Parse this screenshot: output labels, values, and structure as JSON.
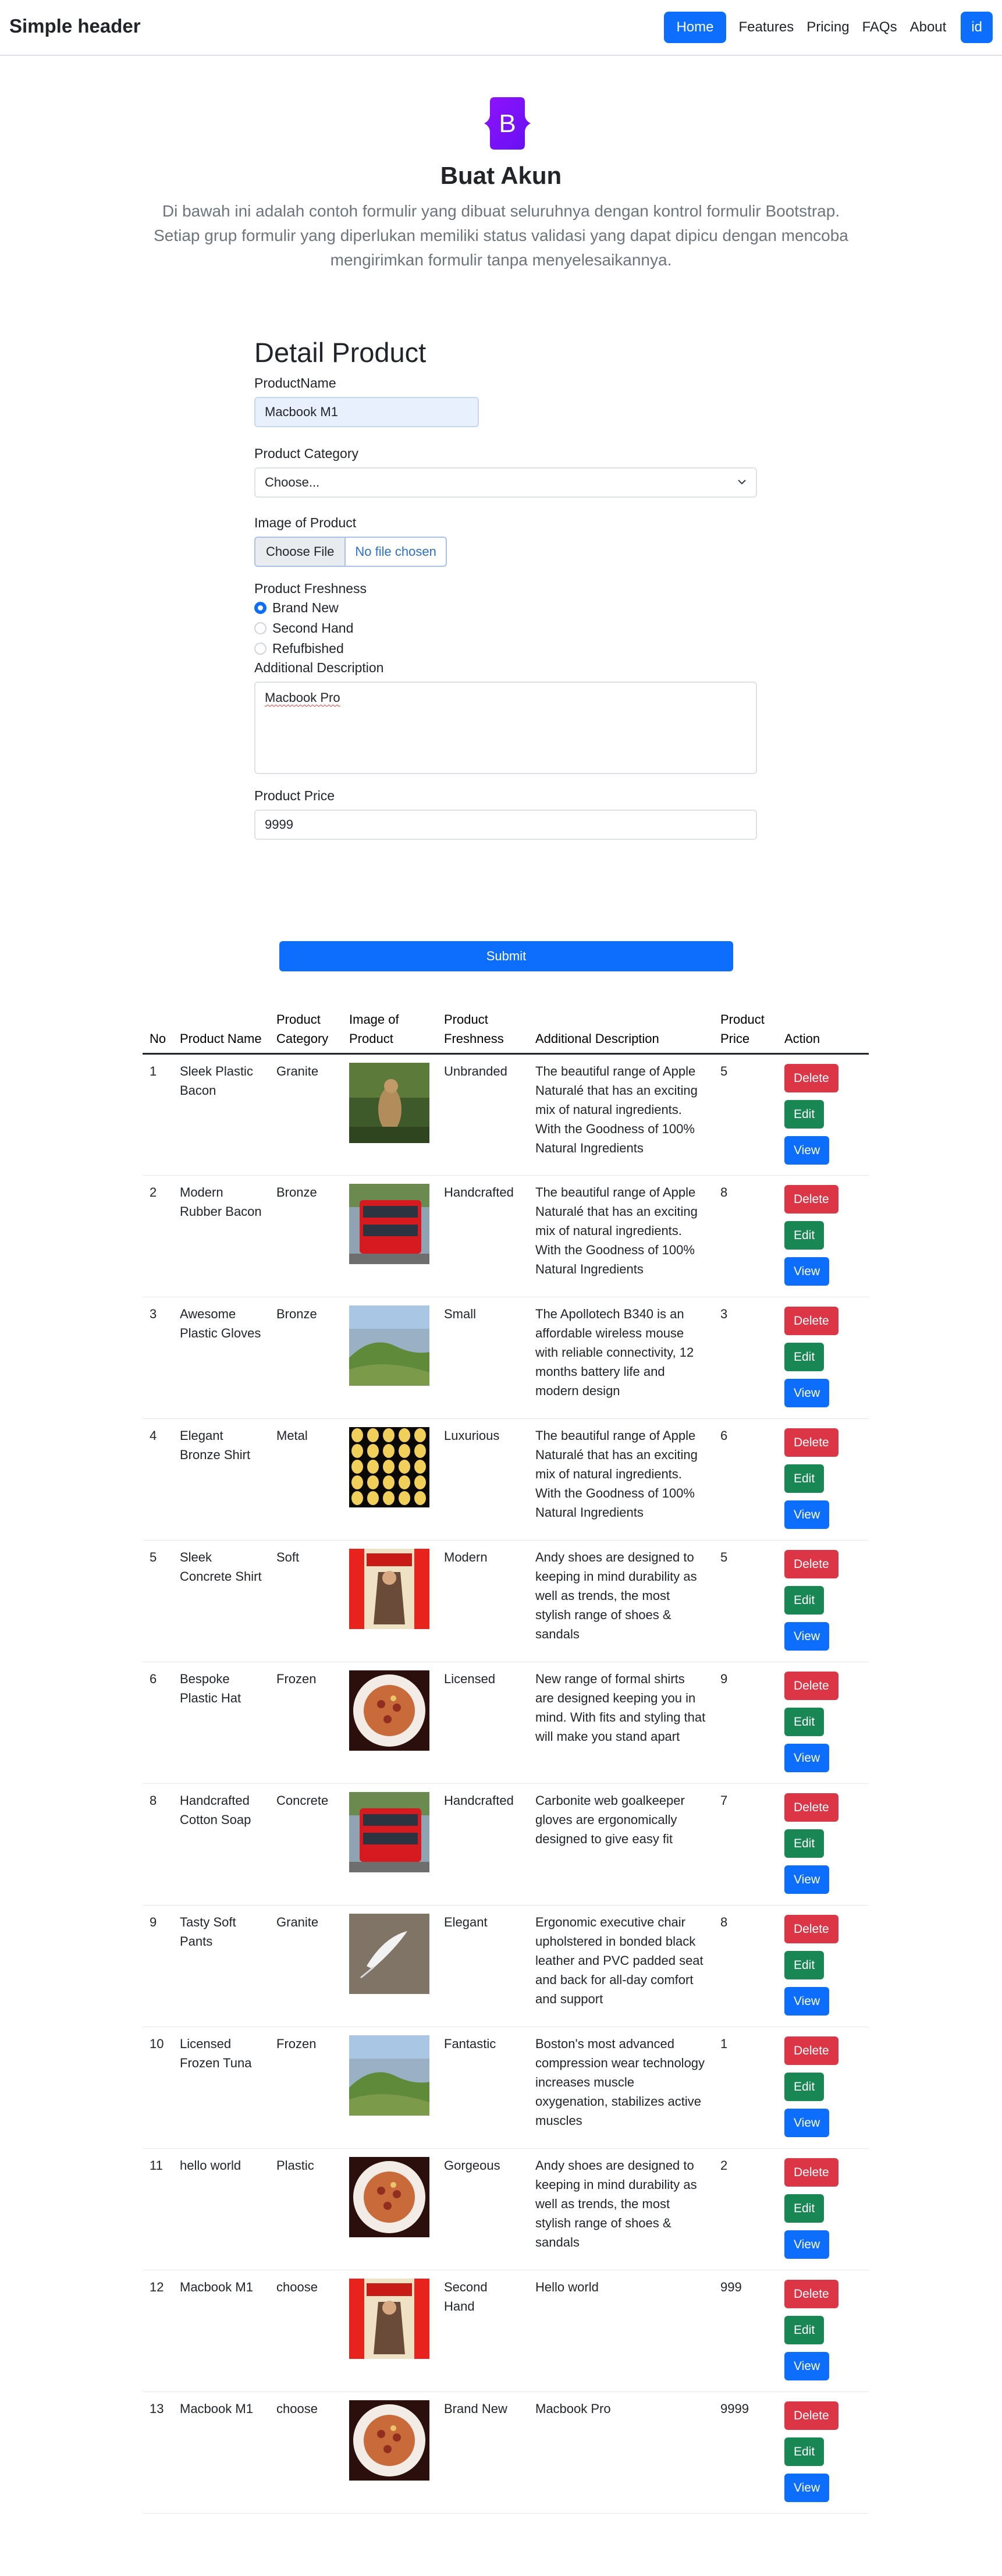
{
  "header": {
    "brand": "Simple header",
    "nav": [
      "Home",
      "Features",
      "Pricing",
      "FAQs",
      "About"
    ],
    "lang_button": "id",
    "colors": {
      "primary": "#0d6efd"
    }
  },
  "hero": {
    "logo_letter": "B",
    "title": "Buat Akun",
    "description": "Di bawah ini adalah contoh formulir yang dibuat seluruhnya dengan kontrol formulir Bootstrap. Setiap grup formulir yang diperlukan memiliki status validasi yang dapat dipicu dengan mencoba mengirimkan formulir tanpa menyelesaikannya."
  },
  "form": {
    "title": "Detail Product",
    "product_name_label": "ProductName",
    "product_name_value": "Macbook M1",
    "category_label": "Product Category",
    "category_value": "Choose...",
    "image_label": "Image of Product",
    "file_button": "Choose File",
    "file_status": "No file chosen",
    "freshness_label": "Product Freshness",
    "freshness_options": [
      "Brand New",
      "Second Hand",
      "Refufbished"
    ],
    "freshness_selected": "Brand New",
    "description_label": "Additional Description",
    "description_value": "Macbook Pro",
    "price_label": "Product Price",
    "price_value": "9999",
    "submit": "Submit"
  },
  "table": {
    "headers": [
      "No",
      "Product Name",
      "Product Category",
      "Image of Product",
      "Product Freshness",
      "Additional Description",
      "Product Price",
      "Action"
    ],
    "action_labels": {
      "delete": "Delete",
      "edit": "Edit",
      "view": "View"
    },
    "rows": [
      {
        "no": "1",
        "name": "Sleek Plastic Bacon",
        "category": "Granite",
        "image": "kangaroo-photo",
        "freshness": "Unbranded",
        "description": "The beautiful range of Apple Naturalé that has an exciting mix of natural ingredients. With the Goodness of 100% Natural Ingredients",
        "price": "5"
      },
      {
        "no": "2",
        "name": "Modern Rubber Bacon",
        "category": "Bronze",
        "image": "red-bus-photo",
        "freshness": "Handcrafted",
        "description": "The beautiful range of Apple Naturalé that has an exciting mix of natural ingredients. With the Goodness of 100% Natural Ingredients",
        "price": "8"
      },
      {
        "no": "3",
        "name": "Awesome Plastic Gloves",
        "category": "Bronze",
        "image": "hill-landscape-photo",
        "freshness": "Small",
        "description": "The Apollotech B340 is an affordable wireless mouse with reliable connectivity, 12 months battery life and modern design",
        "price": "3"
      },
      {
        "no": "4",
        "name": "Elegant Bronze Shirt",
        "category": "Metal",
        "image": "lights-grid-photo",
        "freshness": "Luxurious",
        "description": "The beautiful range of Apple Naturalé that has an exciting mix of natural ingredients. With the Goodness of 100% Natural Ingredients",
        "price": "6"
      },
      {
        "no": "5",
        "name": "Sleek Concrete Shirt",
        "category": "Soft",
        "image": "comic-cover-photo",
        "freshness": "Modern",
        "description": "Andy shoes are designed to keeping in mind durability as well as trends, the most stylish range of shoes & sandals",
        "price": "5"
      },
      {
        "no": "6",
        "name": "Bespoke Plastic Hat",
        "category": "Frozen",
        "image": "pizza-plate-photo",
        "freshness": "Licensed",
        "description": "New range of formal shirts are designed keeping you in mind. With fits and styling that will make you stand apart",
        "price": "9"
      },
      {
        "no": "8",
        "name": "Handcrafted Cotton Soap",
        "category": "Concrete",
        "image": "red-bus-photo",
        "freshness": "Handcrafted",
        "description": "Carbonite web goalkeeper gloves are ergonomically designed to give easy fit",
        "price": "7"
      },
      {
        "no": "9",
        "name": "Tasty Soft Pants",
        "category": "Granite",
        "image": "feather-photo",
        "freshness": "Elegant",
        "description": "Ergonomic executive chair upholstered in bonded black leather and PVC padded seat and back for all-day comfort and support",
        "price": "8"
      },
      {
        "no": "10",
        "name": "Licensed Frozen Tuna",
        "category": "Frozen",
        "image": "hill-landscape-photo",
        "freshness": "Fantastic",
        "description": "Boston's most advanced compression wear technology increases muscle oxygenation, stabilizes active muscles",
        "price": "1"
      },
      {
        "no": "11",
        "name": "hello world",
        "category": "Plastic",
        "image": "pizza-plate-photo",
        "freshness": "Gorgeous",
        "description": "Andy shoes are designed to keeping in mind durability as well as trends, the most stylish range of shoes & sandals",
        "price": "2"
      },
      {
        "no": "12",
        "name": "Macbook M1",
        "category": "choose",
        "image": "comic-cover-photo",
        "freshness": "Second Hand",
        "description": "Hello world",
        "price": "999"
      },
      {
        "no": "13",
        "name": "Macbook M1",
        "category": "choose",
        "image": "pizza-plate-photo",
        "freshness": "Brand New",
        "description": "Macbook Pro",
        "price": "9999"
      }
    ]
  }
}
